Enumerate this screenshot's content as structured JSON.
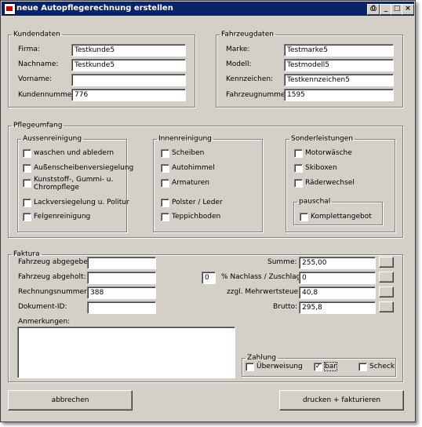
{
  "window": {
    "title": "neue Autopflegerechnung erstellen"
  },
  "titlebar_buttons": {
    "print": "⎙",
    "minimize": "_",
    "maximize": "□",
    "close": "×"
  },
  "kundendaten": {
    "legend": "Kundendaten",
    "fields": [
      {
        "label": "Firma:",
        "value": "Testkunde5"
      },
      {
        "label": "Nachname:",
        "value": "Testkunde5"
      },
      {
        "label": "Vorname:",
        "value": ""
      },
      {
        "label": "Kundennummer:",
        "value": "776"
      }
    ]
  },
  "fahrzeugdaten": {
    "legend": "Fahrzeugdaten",
    "fields": [
      {
        "label": "Marke:",
        "value": "Testmarke5"
      },
      {
        "label": "Modell:",
        "value": "Testmodell5"
      },
      {
        "label": "Kennzeichen:",
        "value": "Testkennzeichen5"
      },
      {
        "label": "Fahrzeugnummer:",
        "value": "1595"
      }
    ]
  },
  "pflegeumfang": {
    "legend": "Pflegeumfang",
    "aussen": {
      "legend": "Aussenreinigung",
      "items": [
        {
          "label": "waschen und abledern",
          "checked": false
        },
        {
          "label": "Außenscheibenversiegelung",
          "checked": false
        },
        {
          "label": "Kunststoff-, Gummi- u.",
          "label2": "Chrompflege",
          "checked": false
        },
        {
          "label": "Lackversiegelung u. Politur",
          "checked": false
        },
        {
          "label": "Felgenreinigung",
          "checked": false
        }
      ]
    },
    "innen": {
      "legend": "Innenreinigung",
      "items": [
        {
          "label": "Scheiben",
          "checked": false
        },
        {
          "label": "Autohimmel",
          "checked": false
        },
        {
          "label": "Armaturen",
          "checked": false
        },
        {
          "label": "Polster / Leder",
          "checked": false
        },
        {
          "label": "Teppichboden",
          "checked": false
        }
      ]
    },
    "sonder": {
      "legend": "Sonderleistungen",
      "items": [
        {
          "label": "Motorwäsche",
          "checked": false
        },
        {
          "label": "Skiboxen",
          "checked": false
        },
        {
          "label": "Räderwechsel",
          "checked": false
        }
      ],
      "pauschal": {
        "legend": "pauschal",
        "label": "Komplettangebot",
        "checked": false
      }
    }
  },
  "faktura": {
    "legend": "Faktura",
    "left_fields": [
      {
        "label": "Fahrzeug abgegeben:",
        "value": ""
      },
      {
        "label": "Fahrzeug abgeholt:",
        "value": ""
      },
      {
        "label": "Rechnungsnummer:",
        "value": "388"
      },
      {
        "label": "Dokument-ID:",
        "value": ""
      }
    ],
    "right_fields": [
      {
        "label": "Summe:",
        "value": "255,00"
      },
      {
        "label": "% Nachlass / Zuschlag:",
        "value": "0"
      },
      {
        "label": "zzgl. Mehrwertsteuer:",
        "value": "40,8"
      },
      {
        "label": "Brutto:",
        "value": "295,8"
      }
    ],
    "nachlass_percent": "0",
    "anmerkungen_label": "Anmerkungen:",
    "anmerkungen_value": "",
    "zahlung": {
      "legend": "Zahlung",
      "options": [
        {
          "label": "Überweisung",
          "checked": false
        },
        {
          "label": "bar",
          "checked": true
        },
        {
          "label": "Scheck",
          "checked": false
        }
      ]
    }
  },
  "buttons": {
    "cancel": "abbrechen",
    "print": "drucken + fakturieren"
  }
}
